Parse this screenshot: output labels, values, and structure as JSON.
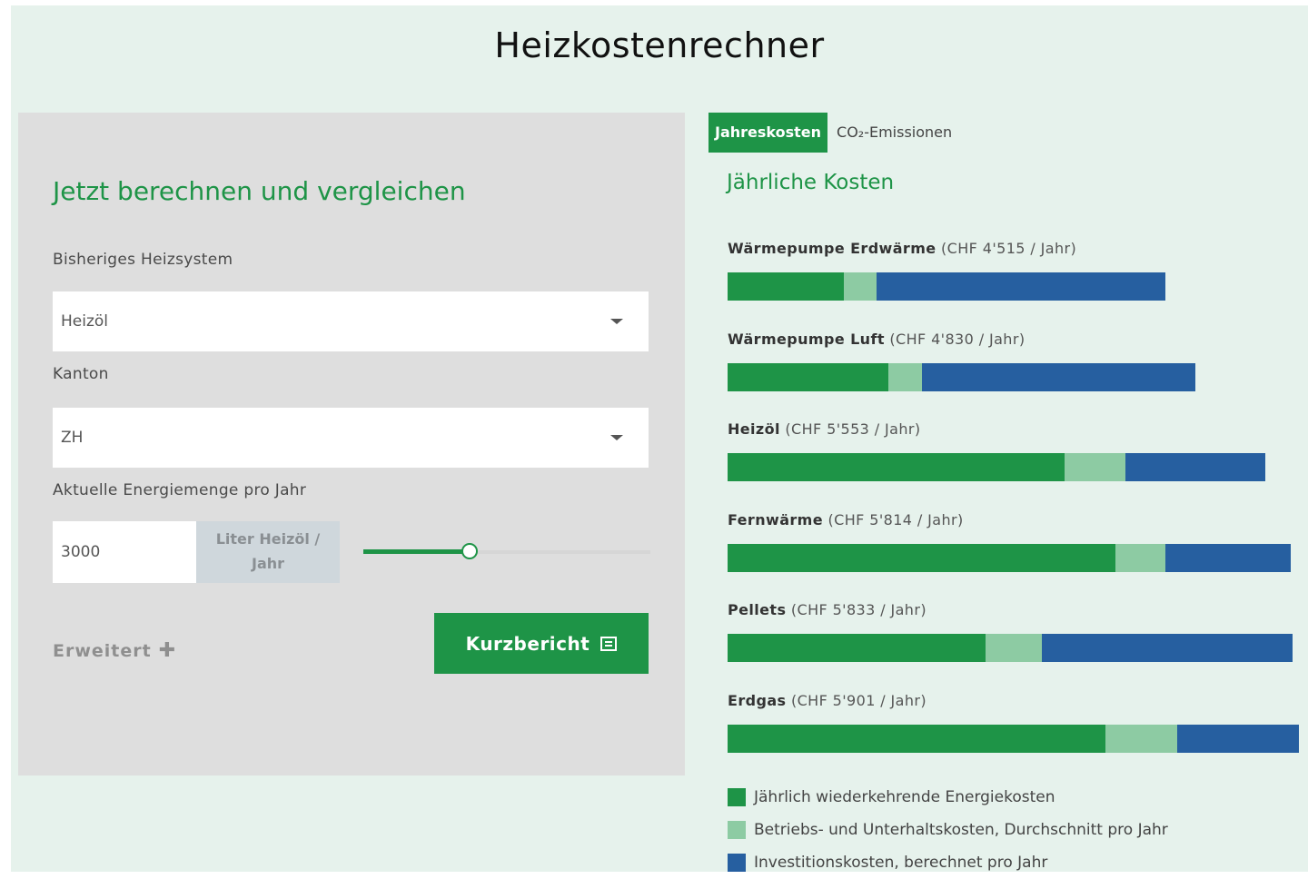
{
  "page": {
    "title": "Heizkostenrechner"
  },
  "form": {
    "heading": "Jetzt berechnen und vergleichen",
    "heating_system": {
      "label": "Bisheriges Heizsystem",
      "value": "Heizöl"
    },
    "canton": {
      "label": "Kanton",
      "value": "ZH"
    },
    "energy": {
      "label": "Aktuelle Energiemenge pro Jahr",
      "value": "3000",
      "unit_line1": "Liter Heizöl /",
      "unit_line2": "Jahr",
      "slider_fraction": 0.37
    },
    "advanced_label": "Erweitert",
    "advanced_icon": "plus-icon",
    "report_button": "Kurzbericht",
    "report_icon": "report-icon"
  },
  "tabs": [
    {
      "label": "Jahreskosten",
      "active": true
    },
    {
      "label": "CO₂-Emissionen",
      "active": false
    }
  ],
  "chart_heading": "Jährliche Kosten",
  "chart_data": {
    "type": "bar",
    "title": "Jährliche Kosten",
    "orientation": "horizontal",
    "stacked": true,
    "categories": [
      "Wärmepumpe Erdwärme",
      "Wärmepumpe Luft",
      "Heizöl",
      "Fernwärme",
      "Pellets",
      "Erdgas"
    ],
    "totals_text": [
      "(CHF 4'515 / Jahr)",
      "(CHF 4'830 / Jahr)",
      "(CHF 5'553 / Jahr)",
      "(CHF 5'814 / Jahr)",
      "(CHF 5'833 / Jahr)",
      "(CHF 5'901 / Jahr)"
    ],
    "totals": [
      4515,
      4830,
      5553,
      5814,
      5833,
      5901
    ],
    "series": [
      {
        "name": "Jährlich wiederkehrende Energiekosten",
        "color": "#1e9447",
        "values": [
          1200,
          1660,
          3480,
          4000,
          2660,
          3900
        ]
      },
      {
        "name": "Betriebs- und Unterhaltskosten, Durchschnitt pro Jahr",
        "color": "#8dcba3",
        "values": [
          340,
          350,
          630,
          520,
          580,
          740
        ]
      },
      {
        "name": "Investitionskosten, berechnet pro Jahr",
        "color": "#265fa0",
        "values": [
          2975,
          2820,
          1443,
          1294,
          2593,
          1261
        ]
      }
    ],
    "legend_position": "bottom"
  }
}
